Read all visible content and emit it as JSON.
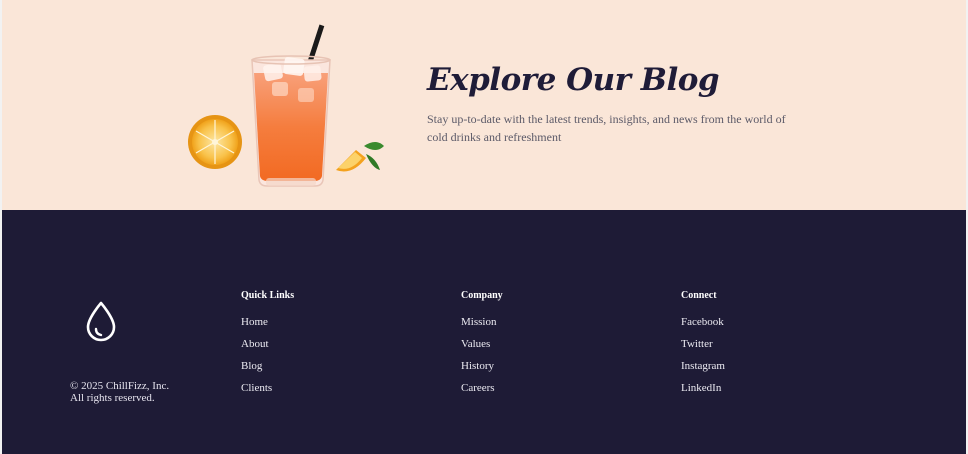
{
  "colors": {
    "hero_background": "#fae6d8",
    "footer_background": "#1e1b36",
    "title_color": "#1f1c38"
  },
  "hero": {
    "image_icon": "orange-drink-illustration",
    "title": "Explore Our Blog",
    "description": "Stay up-to-date with the latest trends, insights, and news from the world of cold drinks and refreshment"
  },
  "footer": {
    "logo_icon": "droplet-icon",
    "copyright_line1": "© 2025 ChillFizz, Inc.",
    "copyright_line2": "All rights reserved.",
    "columns": [
      {
        "heading": "Quick Links",
        "links": [
          "Home",
          "About",
          "Blog",
          "Clients"
        ]
      },
      {
        "heading": "Company",
        "links": [
          "Mission",
          "Values",
          "History",
          "Careers"
        ]
      },
      {
        "heading": "Connect",
        "links": [
          "Facebook",
          "Twitter",
          "Instagram",
          "LinkedIn"
        ]
      }
    ]
  }
}
